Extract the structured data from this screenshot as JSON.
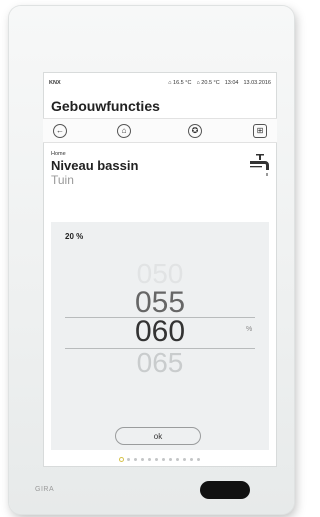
{
  "status_bar": {
    "bus": "KNX",
    "temp1": "16.5 °C",
    "temp2": "20.5 °C",
    "time": "13:04",
    "date": "13.03.2016"
  },
  "app": {
    "title": "Gebouwfuncties"
  },
  "navbar": {
    "back_icon": "arrow-left-icon",
    "home_icon": "home-icon",
    "favorite_icon": "star-circle-icon",
    "grid_icon": "grid-icon"
  },
  "function": {
    "breadcrumb": "Home",
    "title": "Niveau bassin",
    "subtitle": "Tuin",
    "icon": "water-tap-icon"
  },
  "picker": {
    "current_value": "20 %",
    "options": [
      "050",
      "055",
      "060",
      "065"
    ],
    "selected": "060",
    "unit": "%",
    "ok_label": "ok"
  },
  "pagination": {
    "count": 12,
    "active_index": 0
  },
  "device": {
    "brand": "GIRA"
  },
  "colors": {
    "accent": "#d6c24a",
    "background": "#eef0f1"
  }
}
